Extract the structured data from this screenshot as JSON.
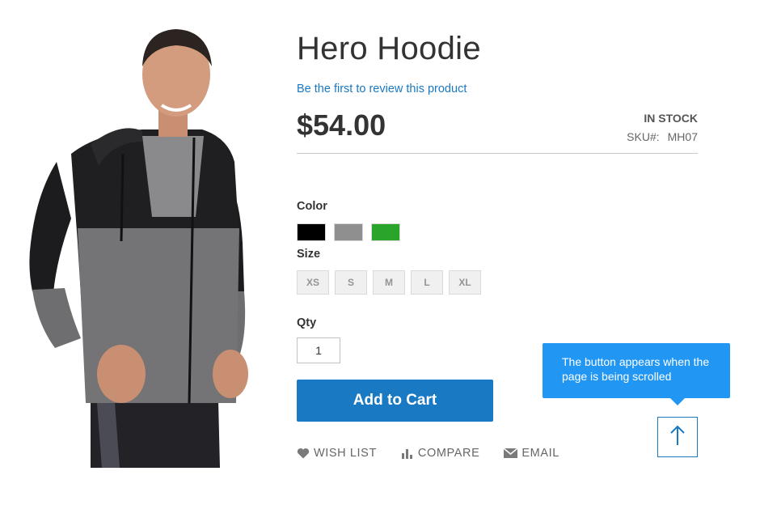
{
  "product": {
    "title": "Hero Hoodie",
    "review_link": "Be the first to review this product",
    "price": "$54.00",
    "stock": "IN STOCK",
    "sku_label": "SKU#:",
    "sku_value": "MH07",
    "image_icon": "product-photo"
  },
  "options": {
    "color_label": "Color",
    "colors": [
      "#000000",
      "#8f8f8f",
      "#2aa52a"
    ],
    "size_label": "Size",
    "sizes": [
      "XS",
      "S",
      "M",
      "L",
      "XL"
    ]
  },
  "qty": {
    "label": "Qty",
    "value": "1"
  },
  "cart": {
    "label": "Add to Cart",
    "color": "#1979c3"
  },
  "actions": {
    "wishlist": {
      "label": "WISH LIST",
      "icon": "heart-icon"
    },
    "compare": {
      "label": "COMPARE",
      "icon": "bar-chart-icon"
    },
    "email": {
      "label": "EMAIL",
      "icon": "envelope-icon"
    }
  },
  "tooltip": {
    "text_line1": "The button appears when the",
    "text_line2": "page is being scrolled",
    "color": "#2196f3"
  },
  "scroll_top": {
    "icon": "arrow-up-icon"
  }
}
